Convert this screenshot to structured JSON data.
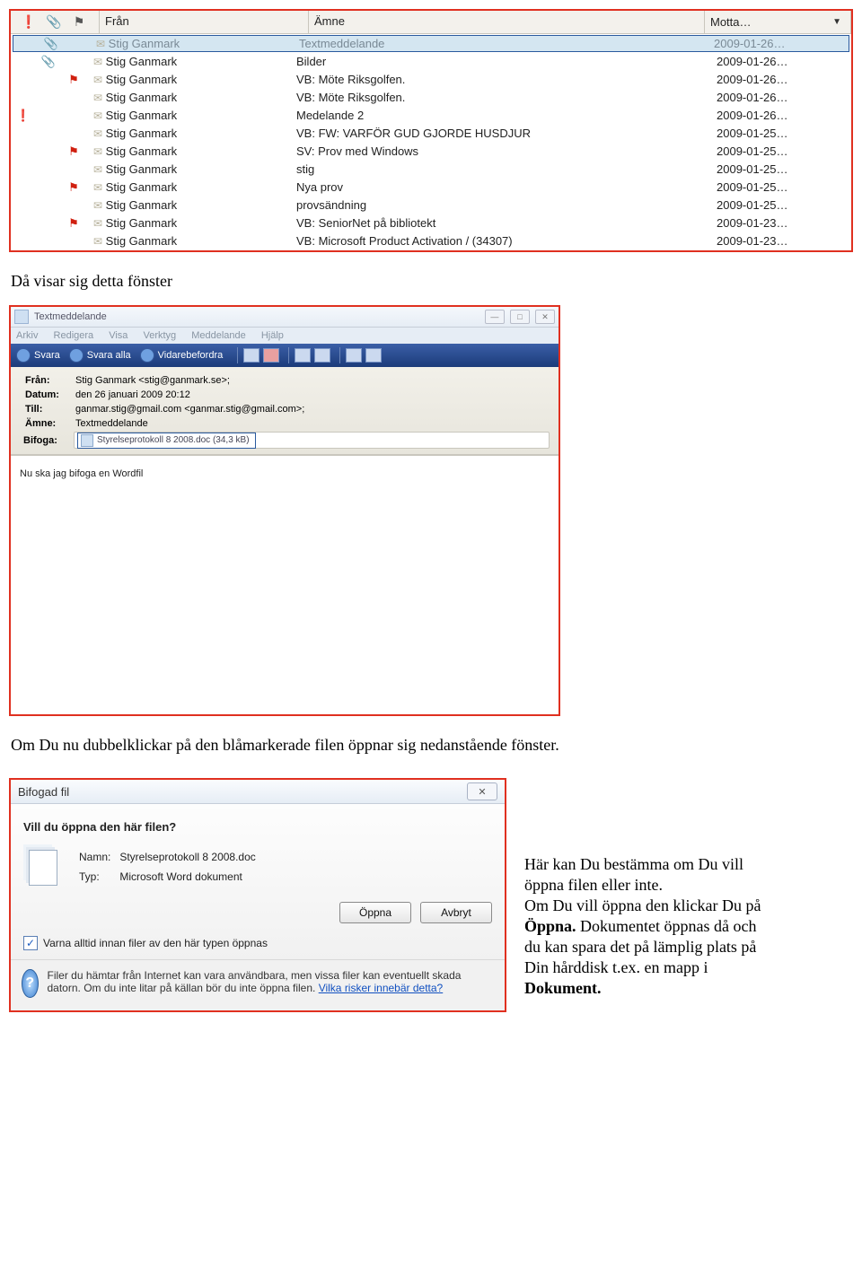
{
  "mail_list": {
    "headers": {
      "from": "Från",
      "subject": "Ämne",
      "date": "Motta…"
    },
    "rows": [
      {
        "selected": true,
        "importance": "",
        "attach": "📎",
        "flag": "",
        "from": "Stig Ganmark",
        "subject": "Textmeddelande",
        "date": "2009-01-26…"
      },
      {
        "selected": false,
        "importance": "",
        "attach": "📎",
        "flag": "",
        "from": "Stig Ganmark",
        "subject": "Bilder",
        "date": "2009-01-26…"
      },
      {
        "selected": false,
        "importance": "",
        "attach": "",
        "flag": "⚑",
        "from": "Stig Ganmark",
        "subject": "VB: Möte Riksgolfen.",
        "date": "2009-01-26…"
      },
      {
        "selected": false,
        "importance": "",
        "attach": "",
        "flag": "",
        "from": "Stig Ganmark",
        "subject": "VB: Möte Riksgolfen.",
        "date": "2009-01-26…"
      },
      {
        "selected": false,
        "importance": "❗",
        "attach": "",
        "flag": "",
        "from": "Stig Ganmark",
        "subject": "Medelande 2",
        "date": "2009-01-26…"
      },
      {
        "selected": false,
        "importance": "",
        "attach": "",
        "flag": "",
        "from": "Stig Ganmark",
        "subject": "VB: FW: VARFÖR GUD GJORDE HUSDJUR",
        "date": "2009-01-25…"
      },
      {
        "selected": false,
        "importance": "",
        "attach": "",
        "flag": "⚑",
        "from": "Stig Ganmark",
        "subject": "SV: Prov med Windows",
        "date": "2009-01-25…"
      },
      {
        "selected": false,
        "importance": "",
        "attach": "",
        "flag": "",
        "from": "Stig Ganmark",
        "subject": "stig",
        "date": "2009-01-25…"
      },
      {
        "selected": false,
        "importance": "",
        "attach": "",
        "flag": "⚑",
        "from": "Stig Ganmark",
        "subject": "Nya prov",
        "date": "2009-01-25…"
      },
      {
        "selected": false,
        "importance": "",
        "attach": "",
        "flag": "",
        "from": "Stig Ganmark",
        "subject": "provsändning",
        "date": "2009-01-25…"
      },
      {
        "selected": false,
        "importance": "",
        "attach": "",
        "flag": "⚑",
        "from": "Stig Ganmark",
        "subject": "VB: SeniorNet på bibliotekt",
        "date": "2009-01-23…"
      },
      {
        "selected": false,
        "importance": "",
        "attach": "",
        "flag": "",
        "from": "Stig Ganmark",
        "subject": "VB: Microsoft Product Activation / (34307)",
        "date": "2009-01-23…"
      }
    ]
  },
  "caption1": "Då visar sig detta fönster",
  "caption2": "Om Du nu dubbelklickar på den blåmarkerade filen öppnar sig nedanstående fönster.",
  "msg": {
    "title": "Textmeddelande",
    "menu": [
      "Arkiv",
      "Redigera",
      "Visa",
      "Verktyg",
      "Meddelande",
      "Hjälp"
    ],
    "toolbar": {
      "reply": "Svara",
      "reply_all": "Svara alla",
      "forward": "Vidarebefordra"
    },
    "hdr": {
      "from_lbl": "Från:",
      "from_val": "Stig Ganmark <stig@ganmark.se>;",
      "date_lbl": "Datum:",
      "date_val": "den 26 januari 2009 20:12",
      "to_lbl": "Till:",
      "to_val": "ganmar.stig@gmail.com <ganmar.stig@gmail.com>;",
      "subj_lbl": "Ämne:",
      "subj_val": "Textmeddelande",
      "att_lbl": "Bifoga:",
      "att_val": "Styrelseprotokoll 8 2008.doc (34,3 kB)"
    },
    "body": "Nu ska jag bifoga en Wordfil"
  },
  "dialog": {
    "title": "Bifogad fil",
    "question": "Vill du öppna den här filen?",
    "name_lbl": "Namn:",
    "name_val": "Styrelseprotokoll 8 2008.doc",
    "type_lbl": "Typ:",
    "type_val": "Microsoft Word dokument",
    "open": "Öppna",
    "cancel": "Avbryt",
    "chk": "Varna alltid innan filer av den här typen öppnas",
    "warn_text": "Filer du hämtar från Internet kan vara användbara, men vissa filer kan eventuellt skada datorn. Om du inte litar på källan bör du inte öppna filen. ",
    "warn_link": "Vilka risker innebär detta?"
  },
  "side": {
    "l1": "Här kan Du bestämma om Du vill",
    "l2": "öppna filen eller inte.",
    "l3a": "Om Du vill öppna den klickar Du på",
    "l3b": "Öppna.",
    "l3c": " Dokumentet öppnas då och",
    "l4": "du kan spara det på lämplig plats på",
    "l5": "Din hårddisk t.ex. en mapp i",
    "l6": "Dokument."
  }
}
